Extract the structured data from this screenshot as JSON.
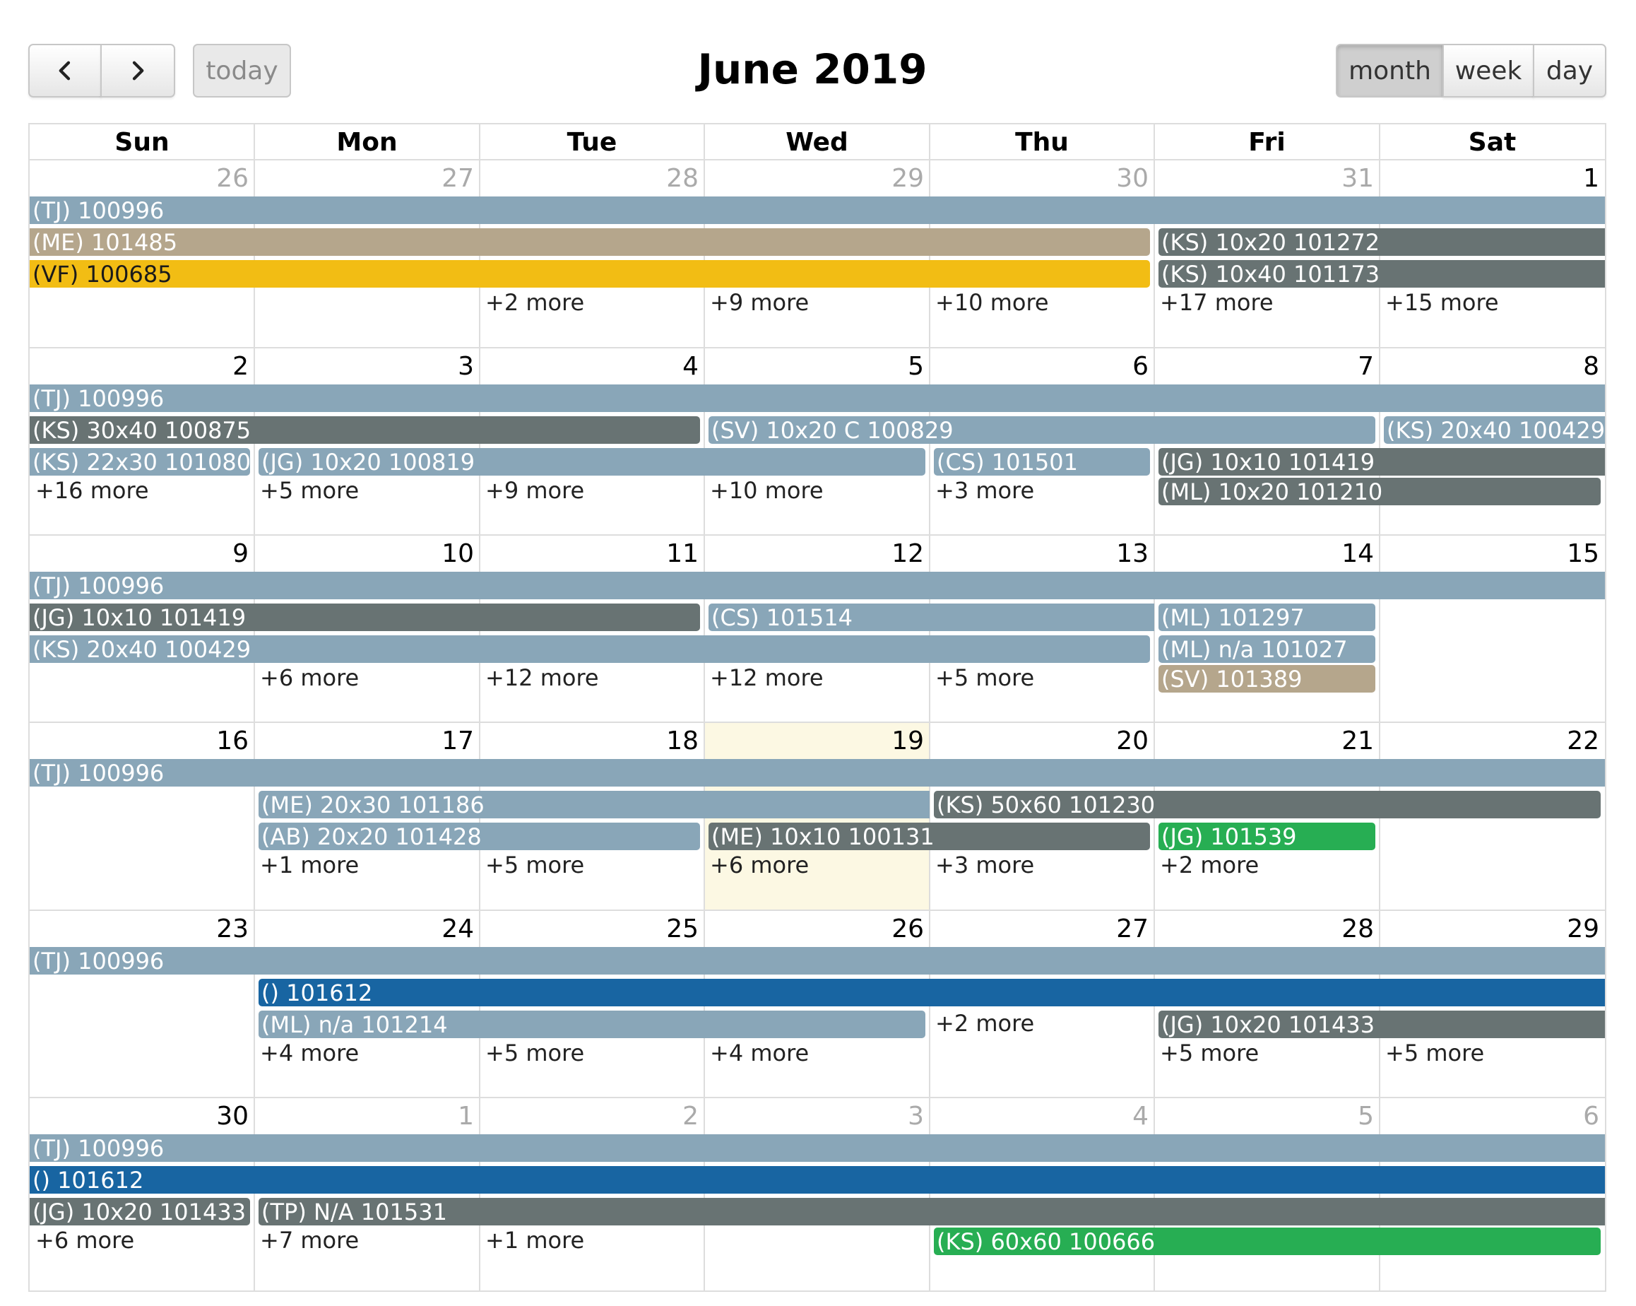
{
  "toolbar": {
    "title": "June 2019",
    "today_label": "today",
    "views": [
      "month",
      "week",
      "day"
    ],
    "active_view": "month"
  },
  "colors": {
    "steel": "#89a6b8",
    "slate": "#687373",
    "tan": "#b5a68c",
    "gold": "#f2bd14",
    "blue": "#1865a2",
    "green": "#27ae53",
    "today_bg": "#fcf8e3"
  },
  "calendar": {
    "day_headers": [
      "Sun",
      "Mon",
      "Tue",
      "Wed",
      "Thu",
      "Fri",
      "Sat"
    ],
    "today": "19",
    "weeks": [
      {
        "days": [
          {
            "n": "26",
            "other": true
          },
          {
            "n": "27",
            "other": true
          },
          {
            "n": "28",
            "other": true
          },
          {
            "n": "29",
            "other": true
          },
          {
            "n": "30",
            "other": true
          },
          {
            "n": "31",
            "other": true
          },
          {
            "n": "1",
            "other": false
          }
        ],
        "events": [
          {
            "label": "(TJ) 100996",
            "start": 0,
            "end": 6,
            "row": 0,
            "color": "steel"
          },
          {
            "label": "(ME) 101485",
            "start": 0,
            "end": 4,
            "row": 1,
            "color": "tan",
            "end_cap": true
          },
          {
            "label": "(KS) 10x20 101272",
            "start": 5,
            "end": 6,
            "row": 1,
            "color": "slate",
            "start_cap": true
          },
          {
            "label": "(VF) 100685",
            "start": 0,
            "end": 4,
            "row": 2,
            "color": "gold",
            "end_cap": true,
            "dark": true
          },
          {
            "label": "(KS) 10x40 101173",
            "start": 5,
            "end": 6,
            "row": 2,
            "color": "slate",
            "start_cap": true
          }
        ],
        "more": [
          {
            "col": 2,
            "row": 3,
            "label": "+2 more"
          },
          {
            "col": 3,
            "row": 3,
            "label": "+9 more"
          },
          {
            "col": 4,
            "row": 3,
            "label": "+10 more"
          },
          {
            "col": 5,
            "row": 3,
            "label": "+17 more"
          },
          {
            "col": 6,
            "row": 3,
            "label": "+15 more"
          }
        ]
      },
      {
        "days": [
          {
            "n": "2"
          },
          {
            "n": "3"
          },
          {
            "n": "4"
          },
          {
            "n": "5"
          },
          {
            "n": "6"
          },
          {
            "n": "7"
          },
          {
            "n": "8"
          }
        ],
        "events": [
          {
            "label": "(TJ) 100996",
            "start": 0,
            "end": 6,
            "row": 0,
            "color": "steel"
          },
          {
            "label": "(KS) 30x40 100875",
            "start": 0,
            "end": 2,
            "row": 1,
            "color": "slate",
            "end_cap": true
          },
          {
            "label": "(SV) 10x20 C 100829",
            "start": 3,
            "end": 5,
            "row": 1,
            "color": "steel",
            "start_cap": true,
            "end_cap": true
          },
          {
            "label": "(KS) 20x40 100429",
            "start": 6,
            "end": 6,
            "row": 1,
            "color": "steel",
            "start_cap": true
          },
          {
            "label": "(KS) 22x30 101080",
            "start": 0,
            "end": 0,
            "row": 2,
            "color": "steel",
            "end_cap": true
          },
          {
            "label": "(JG) 10x20 100819",
            "start": 1,
            "end": 3,
            "row": 2,
            "color": "steel",
            "start_cap": true,
            "end_cap": true
          },
          {
            "label": "(CS) 101501",
            "start": 4,
            "end": 4,
            "row": 2,
            "color": "steel",
            "start_cap": true,
            "end_cap": true
          },
          {
            "label": "(JG) 10x10 101419",
            "start": 5,
            "end": 6,
            "row": 2,
            "color": "slate",
            "start_cap": true
          },
          {
            "label": "(ML) 10x20 101210",
            "start": 5,
            "end": 6,
            "row": 3,
            "color": "slate",
            "start_cap": true,
            "end_cap": true
          }
        ],
        "more": [
          {
            "col": 0,
            "row": 3,
            "label": "+16 more"
          },
          {
            "col": 1,
            "row": 3,
            "label": "+5 more"
          },
          {
            "col": 2,
            "row": 3,
            "label": "+9 more"
          },
          {
            "col": 3,
            "row": 3,
            "label": "+10 more"
          },
          {
            "col": 4,
            "row": 3,
            "label": "+3 more"
          }
        ]
      },
      {
        "days": [
          {
            "n": "9"
          },
          {
            "n": "10"
          },
          {
            "n": "11"
          },
          {
            "n": "12"
          },
          {
            "n": "13"
          },
          {
            "n": "14"
          },
          {
            "n": "15"
          }
        ],
        "events": [
          {
            "label": "(TJ) 100996",
            "start": 0,
            "end": 6,
            "row": 0,
            "color": "steel"
          },
          {
            "label": "(JG) 10x10 101419",
            "start": 0,
            "end": 2,
            "row": 1,
            "color": "slate",
            "end_cap": true
          },
          {
            "label": "(CS) 101514",
            "start": 3,
            "end": 4,
            "row": 1,
            "color": "steel",
            "start_cap": true
          },
          {
            "label": "(ML) 101297",
            "start": 5,
            "end": 5,
            "row": 1,
            "color": "steel",
            "start_cap": true,
            "end_cap": true
          },
          {
            "label": "(KS) 20x40 100429",
            "start": 0,
            "end": 4,
            "row": 2,
            "color": "steel",
            "end_cap": true
          },
          {
            "label": "(ML) n/a 101027",
            "start": 5,
            "end": 5,
            "row": 2,
            "color": "steel",
            "start_cap": true,
            "end_cap": true
          },
          {
            "label": "(SV) 101389",
            "start": 5,
            "end": 5,
            "row": 3,
            "color": "tan",
            "start_cap": true,
            "end_cap": true
          }
        ],
        "more": [
          {
            "col": 1,
            "row": 3,
            "label": "+6 more"
          },
          {
            "col": 2,
            "row": 3,
            "label": "+12 more"
          },
          {
            "col": 3,
            "row": 3,
            "label": "+12 more"
          },
          {
            "col": 4,
            "row": 3,
            "label": "+5 more"
          }
        ]
      },
      {
        "days": [
          {
            "n": "16"
          },
          {
            "n": "17"
          },
          {
            "n": "18"
          },
          {
            "n": "19",
            "today": true
          },
          {
            "n": "20"
          },
          {
            "n": "21"
          },
          {
            "n": "22"
          }
        ],
        "events": [
          {
            "label": "(TJ) 100996",
            "start": 0,
            "end": 6,
            "row": 0,
            "color": "steel"
          },
          {
            "label": "(ME) 20x30 101186",
            "start": 1,
            "end": 3,
            "row": 1,
            "color": "steel",
            "start_cap": true
          },
          {
            "label": "(KS) 50x60 101230",
            "start": 4,
            "end": 6,
            "row": 1,
            "color": "slate",
            "start_cap": true,
            "end_cap": true
          },
          {
            "label": "(AB) 20x20 101428",
            "start": 1,
            "end": 2,
            "row": 2,
            "color": "steel",
            "start_cap": true,
            "end_cap": true
          },
          {
            "label": "(ME) 10x10 100131",
            "start": 3,
            "end": 4,
            "row": 2,
            "color": "slate",
            "start_cap": true,
            "end_cap": true
          },
          {
            "label": "(JG) 101539",
            "start": 5,
            "end": 5,
            "row": 2,
            "color": "green",
            "start_cap": true,
            "end_cap": true
          }
        ],
        "more": [
          {
            "col": 1,
            "row": 3,
            "label": "+1 more"
          },
          {
            "col": 2,
            "row": 3,
            "label": "+5 more"
          },
          {
            "col": 3,
            "row": 3,
            "label": "+6 more"
          },
          {
            "col": 4,
            "row": 3,
            "label": "+3 more"
          },
          {
            "col": 5,
            "row": 3,
            "label": "+2 more"
          }
        ]
      },
      {
        "days": [
          {
            "n": "23"
          },
          {
            "n": "24"
          },
          {
            "n": "25"
          },
          {
            "n": "26"
          },
          {
            "n": "27"
          },
          {
            "n": "28"
          },
          {
            "n": "29"
          }
        ],
        "events": [
          {
            "label": "(TJ) 100996",
            "start": 0,
            "end": 6,
            "row": 0,
            "color": "steel"
          },
          {
            "label": "() 101612",
            "start": 1,
            "end": 6,
            "row": 1,
            "color": "blue",
            "start_cap": true
          },
          {
            "label": "(ML) n/a 101214",
            "start": 1,
            "end": 3,
            "row": 2,
            "color": "steel",
            "start_cap": true,
            "end_cap": true
          },
          {
            "label": "(JG) 10x20 101433",
            "start": 5,
            "end": 6,
            "row": 2,
            "color": "slate",
            "start_cap": true
          }
        ],
        "more": [
          {
            "col": 4,
            "row": 2,
            "label": "+2 more"
          },
          {
            "col": 1,
            "row": 3,
            "label": "+4 more"
          },
          {
            "col": 2,
            "row": 3,
            "label": "+5 more"
          },
          {
            "col": 3,
            "row": 3,
            "label": "+4 more"
          },
          {
            "col": 5,
            "row": 3,
            "label": "+5 more"
          },
          {
            "col": 6,
            "row": 3,
            "label": "+5 more"
          }
        ]
      },
      {
        "days": [
          {
            "n": "30"
          },
          {
            "n": "1",
            "other": true
          },
          {
            "n": "2",
            "other": true
          },
          {
            "n": "3",
            "other": true
          },
          {
            "n": "4",
            "other": true
          },
          {
            "n": "5",
            "other": true
          },
          {
            "n": "6",
            "other": true
          }
        ],
        "events": [
          {
            "label": "(TJ) 100996",
            "start": 0,
            "end": 6,
            "row": 0,
            "color": "steel"
          },
          {
            "label": "() 101612",
            "start": 0,
            "end": 6,
            "row": 1,
            "color": "blue"
          },
          {
            "label": "(JG) 10x20 101433",
            "start": 0,
            "end": 0,
            "row": 2,
            "color": "slate",
            "end_cap": true
          },
          {
            "label": "(TP) N/A 101531",
            "start": 1,
            "end": 6,
            "row": 2,
            "color": "slate",
            "start_cap": true
          },
          {
            "label": "(KS) 60x60 100666",
            "start": 4,
            "end": 6,
            "row": 3,
            "color": "green",
            "start_cap": true,
            "end_cap": true
          }
        ],
        "more": [
          {
            "col": 0,
            "row": 3,
            "label": "+6 more"
          },
          {
            "col": 1,
            "row": 3,
            "label": "+7 more"
          },
          {
            "col": 2,
            "row": 3,
            "label": "+1 more"
          }
        ]
      }
    ]
  }
}
